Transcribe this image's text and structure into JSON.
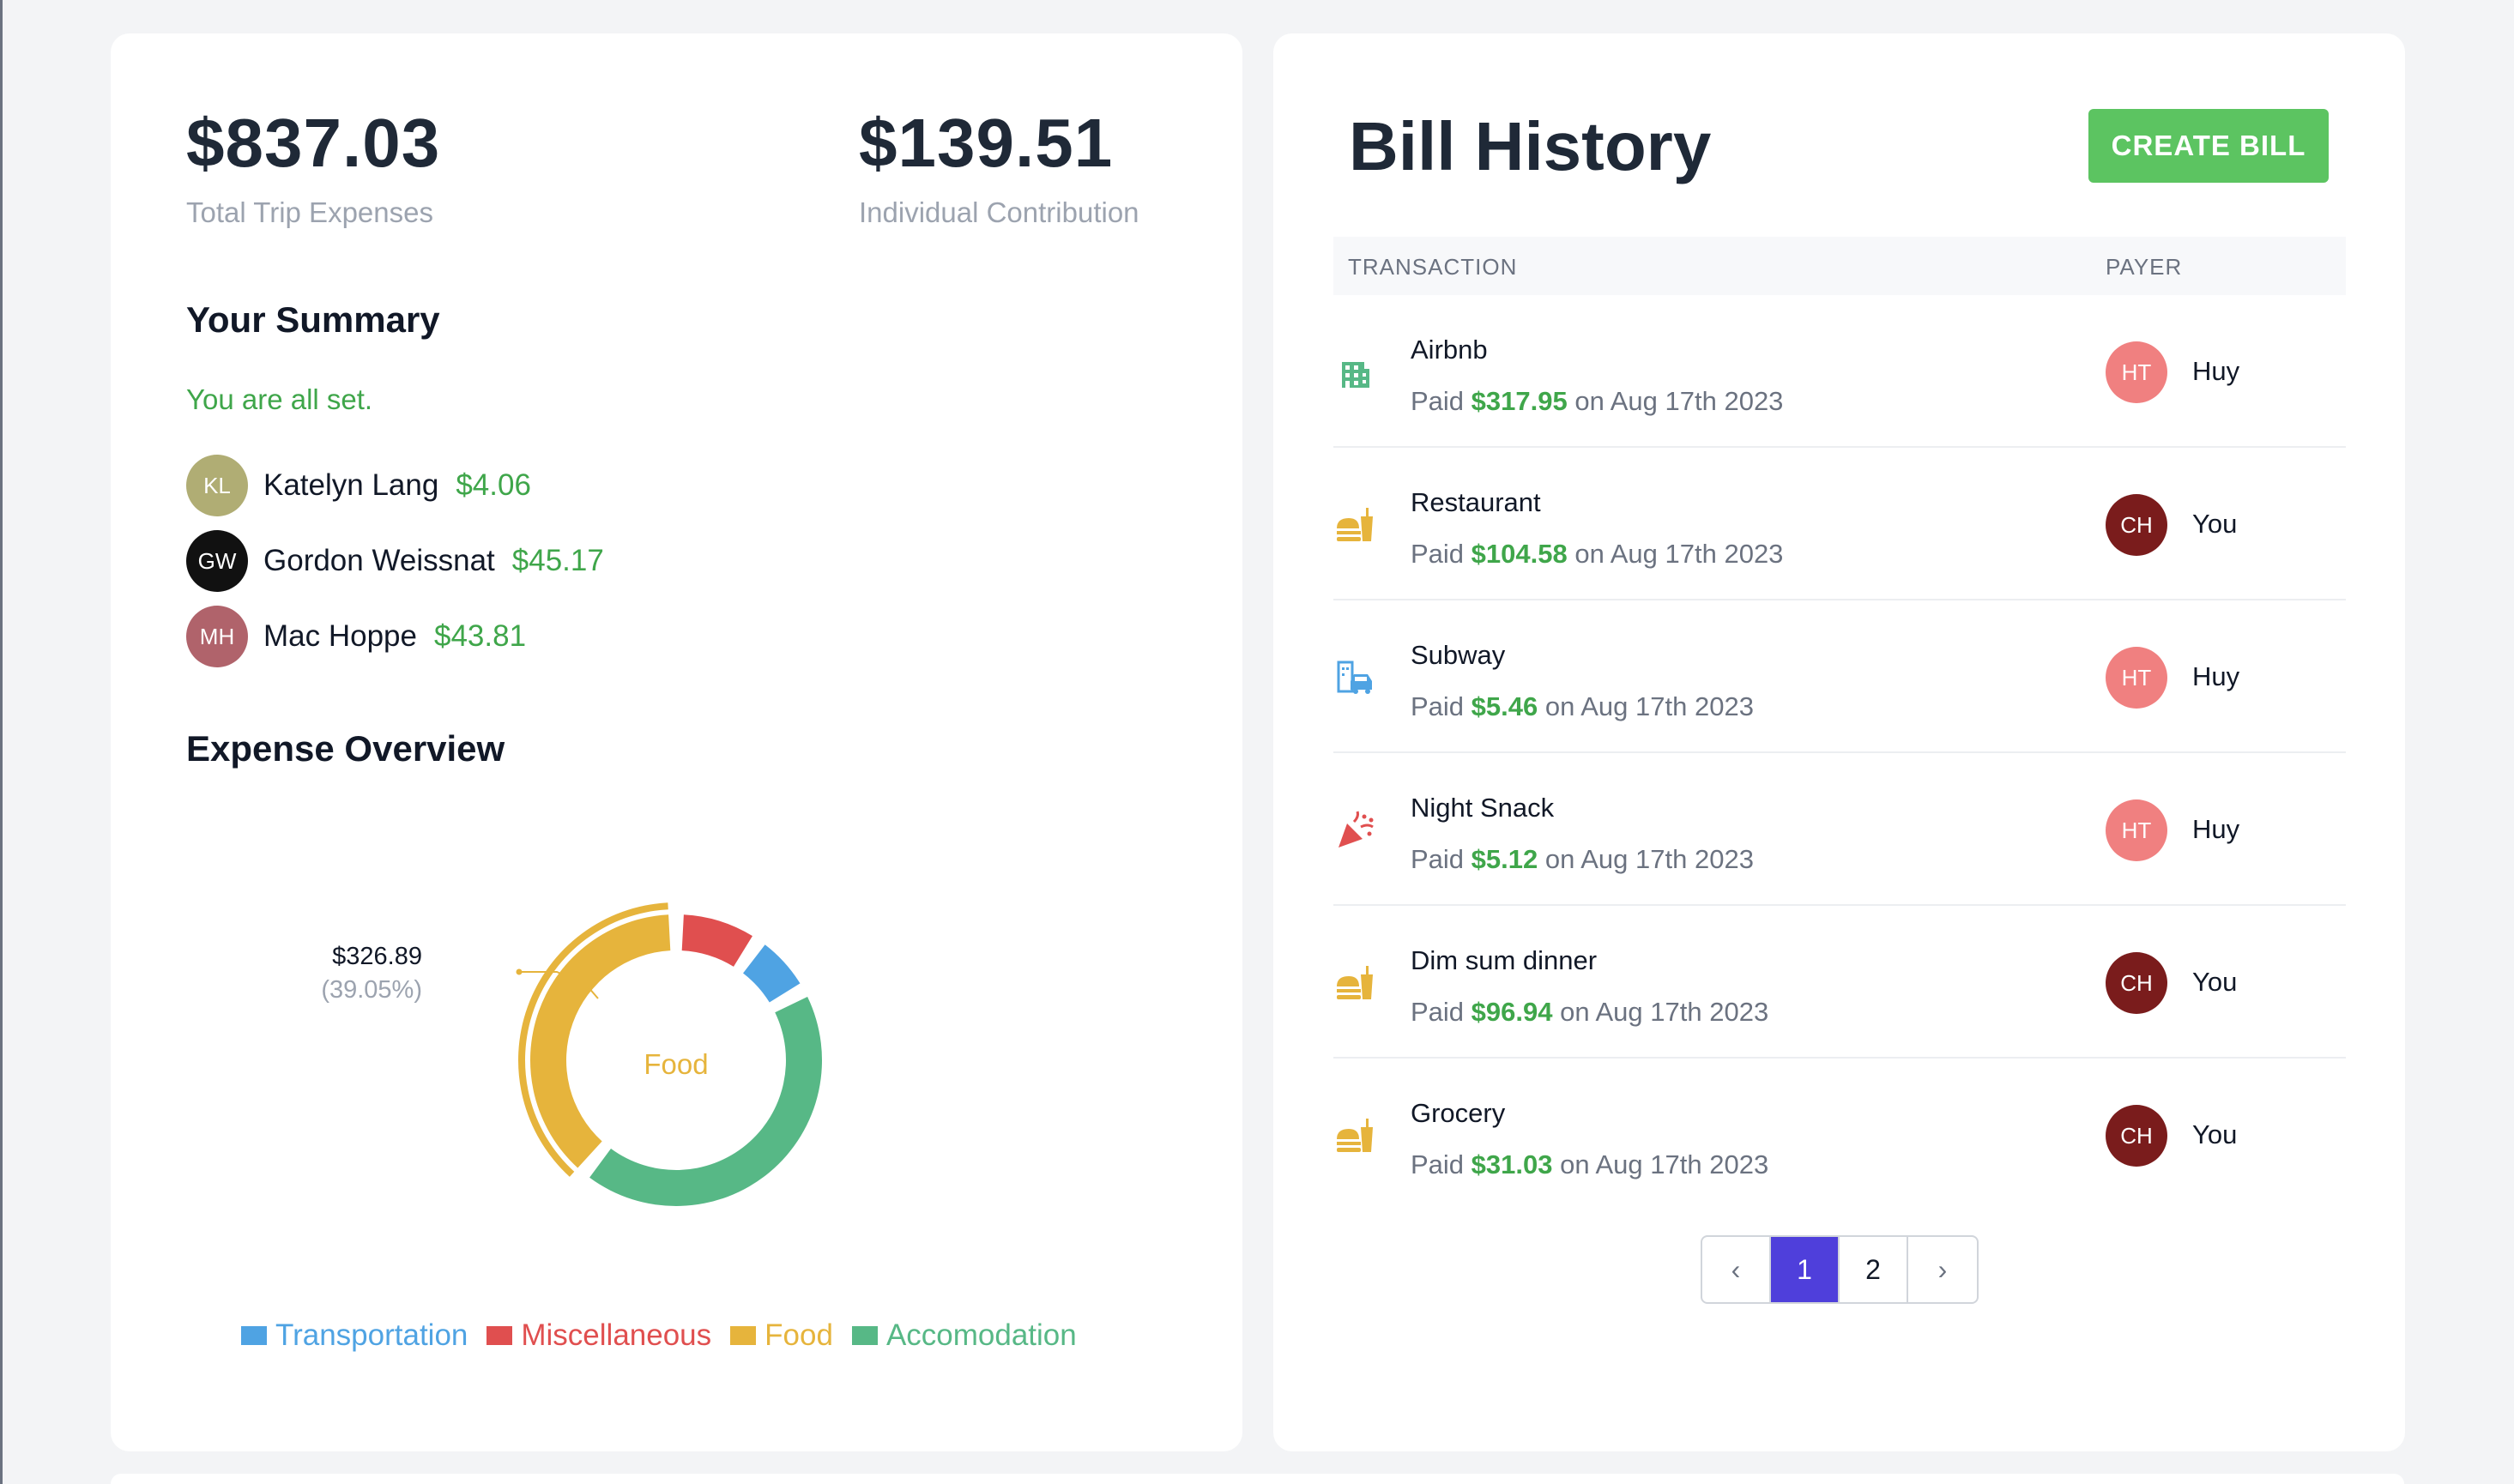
{
  "summary": {
    "total_amount": "$837.03",
    "total_label": "Total Trip Expenses",
    "individual_amount": "$139.51",
    "individual_label": "Individual Contribution",
    "your_summary_title": "Your Summary",
    "status_text": "You are all set.",
    "people": [
      {
        "initials": "KL",
        "name": "Katelyn Lang",
        "amount": "$4.06",
        "color": "#b0ad74"
      },
      {
        "initials": "GW",
        "name": "Gordon Weissnat",
        "amount": "$45.17",
        "color": "#111111"
      },
      {
        "initials": "MH",
        "name": "Mac Hoppe",
        "amount": "$43.81",
        "color": "#b0636b"
      }
    ]
  },
  "expense_overview": {
    "title": "Expense Overview",
    "center_label": "Food",
    "callout_value": "$326.89",
    "callout_percent": "(39.05%)"
  },
  "chart_data": {
    "type": "pie",
    "style": "donut",
    "categories": [
      "Transportation",
      "Miscellaneous",
      "Food",
      "Accomodation"
    ],
    "values": [
      7.4,
      9.6,
      39.05,
      43.95
    ],
    "colors": [
      "#4fa3e3",
      "#e04f4f",
      "#e6b43c",
      "#57b886"
    ],
    "highlighted": "Food",
    "legend_position": "bottom"
  },
  "bill_history": {
    "title": "Bill History",
    "create_button": "CREATE BILL",
    "col_transaction": "TRANSACTION",
    "col_payer": "PAYER",
    "rows": [
      {
        "title": "Airbnb",
        "paid": "Paid",
        "amount": "$317.95",
        "date": "on Aug 17th 2023",
        "icon": "hotel-icon",
        "initials": "HT",
        "payer": "Huy",
        "payer_color": "#f08080"
      },
      {
        "title": "Restaurant",
        "paid": "Paid",
        "amount": "$104.58",
        "date": "on Aug 17th 2023",
        "icon": "food-icon",
        "initials": "CH",
        "payer": "You",
        "payer_color": "#7a1c1c"
      },
      {
        "title": "Subway",
        "paid": "Paid",
        "amount": "$5.46",
        "date": "on Aug 17th 2023",
        "icon": "transportation-icon",
        "initials": "HT",
        "payer": "Huy",
        "payer_color": "#f08080"
      },
      {
        "title": "Night Snack",
        "paid": "Paid",
        "amount": "$5.12",
        "date": "on Aug 17th 2023",
        "icon": "party-popper-icon",
        "initials": "HT",
        "payer": "Huy",
        "payer_color": "#f08080"
      },
      {
        "title": "Dim sum dinner",
        "paid": "Paid",
        "amount": "$96.94",
        "date": "on Aug 17th 2023",
        "icon": "food-icon",
        "initials": "CH",
        "payer": "You",
        "payer_color": "#7a1c1c"
      },
      {
        "title": "Grocery",
        "paid": "Paid",
        "amount": "$31.03",
        "date": "on Aug 17th 2023",
        "icon": "food-icon",
        "initials": "CH",
        "payer": "You",
        "payer_color": "#7a1c1c"
      }
    ],
    "pagination": {
      "prev": "‹",
      "pages": [
        "1",
        "2"
      ],
      "current": "1",
      "next": "›"
    }
  }
}
